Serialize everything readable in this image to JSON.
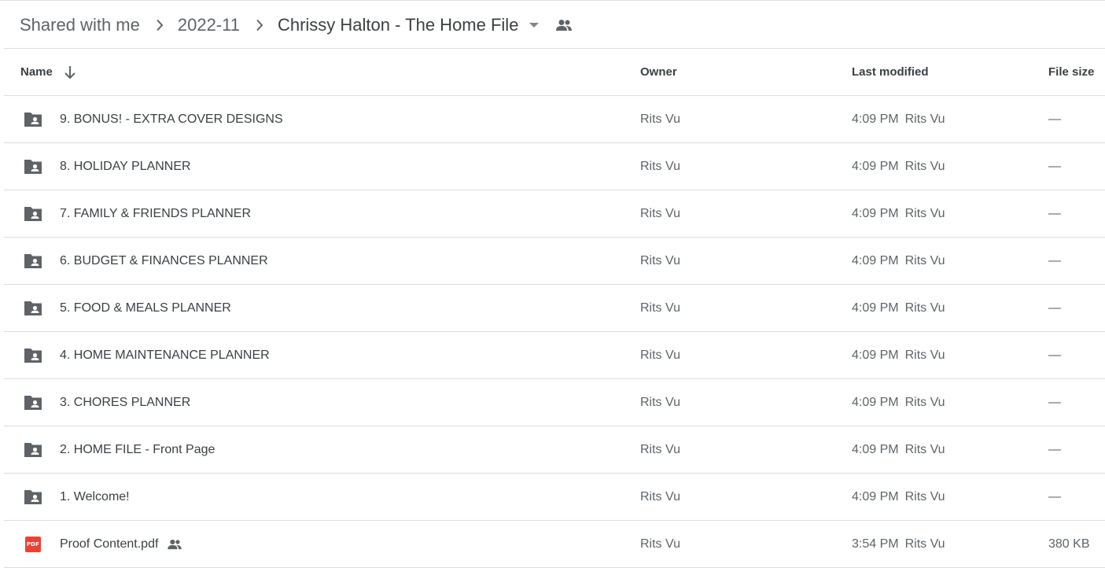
{
  "breadcrumb": {
    "items": [
      {
        "label": "Shared with me"
      },
      {
        "label": "2022-11"
      },
      {
        "label": "Chrissy Halton - The Home File"
      }
    ]
  },
  "table": {
    "headers": {
      "name": "Name",
      "owner": "Owner",
      "last_modified": "Last modified",
      "file_size": "File size"
    },
    "sort": {
      "column": "name",
      "direction": "descending",
      "icon": "arrow-down-icon"
    },
    "rows": [
      {
        "type": "shared-folder",
        "icon": "shared-folder-icon",
        "name": "9. BONUS! - EXTRA COVER DESIGNS",
        "owner": "Rits Vu",
        "modified_time": "4:09 PM",
        "modified_by": "Rits Vu",
        "size": "—"
      },
      {
        "type": "shared-folder",
        "icon": "shared-folder-icon",
        "name": "8. HOLIDAY PLANNER",
        "owner": "Rits Vu",
        "modified_time": "4:09 PM",
        "modified_by": "Rits Vu",
        "size": "—"
      },
      {
        "type": "shared-folder",
        "icon": "shared-folder-icon",
        "name": "7. FAMILY & FRIENDS PLANNER",
        "owner": "Rits Vu",
        "modified_time": "4:09 PM",
        "modified_by": "Rits Vu",
        "size": "—"
      },
      {
        "type": "shared-folder",
        "icon": "shared-folder-icon",
        "name": "6. BUDGET & FINANCES PLANNER",
        "owner": "Rits Vu",
        "modified_time": "4:09 PM",
        "modified_by": "Rits Vu",
        "size": "—"
      },
      {
        "type": "shared-folder",
        "icon": "shared-folder-icon",
        "name": "5. FOOD & MEALS PLANNER",
        "owner": "Rits Vu",
        "modified_time": "4:09 PM",
        "modified_by": "Rits Vu",
        "size": "—"
      },
      {
        "type": "shared-folder",
        "icon": "shared-folder-icon",
        "name": "4. HOME MAINTENANCE PLANNER",
        "owner": "Rits Vu",
        "modified_time": "4:09 PM",
        "modified_by": "Rits Vu",
        "size": "—"
      },
      {
        "type": "shared-folder",
        "icon": "shared-folder-icon",
        "name": "3. CHORES PLANNER",
        "owner": "Rits Vu",
        "modified_time": "4:09 PM",
        "modified_by": "Rits Vu",
        "size": "—"
      },
      {
        "type": "shared-folder",
        "icon": "shared-folder-icon",
        "name": "2. HOME FILE - Front Page",
        "owner": "Rits Vu",
        "modified_time": "4:09 PM",
        "modified_by": "Rits Vu",
        "size": "—"
      },
      {
        "type": "shared-folder",
        "icon": "shared-folder-icon",
        "name": "1. Welcome!",
        "owner": "Rits Vu",
        "modified_time": "4:09 PM",
        "modified_by": "Rits Vu",
        "size": "—"
      },
      {
        "type": "pdf",
        "icon": "pdf-icon",
        "icon_label": "PDF",
        "name": "Proof Content.pdf",
        "shared": true,
        "owner": "Rits Vu",
        "modified_time": "3:54 PM",
        "modified_by": "Rits Vu",
        "size": "380 KB"
      }
    ]
  },
  "colors": {
    "text_primary": "#3c4043",
    "text_secondary": "#5f6368",
    "divider": "#dadce0",
    "folder_icon": "#5f6368",
    "pdf_red": "#ea4335"
  }
}
